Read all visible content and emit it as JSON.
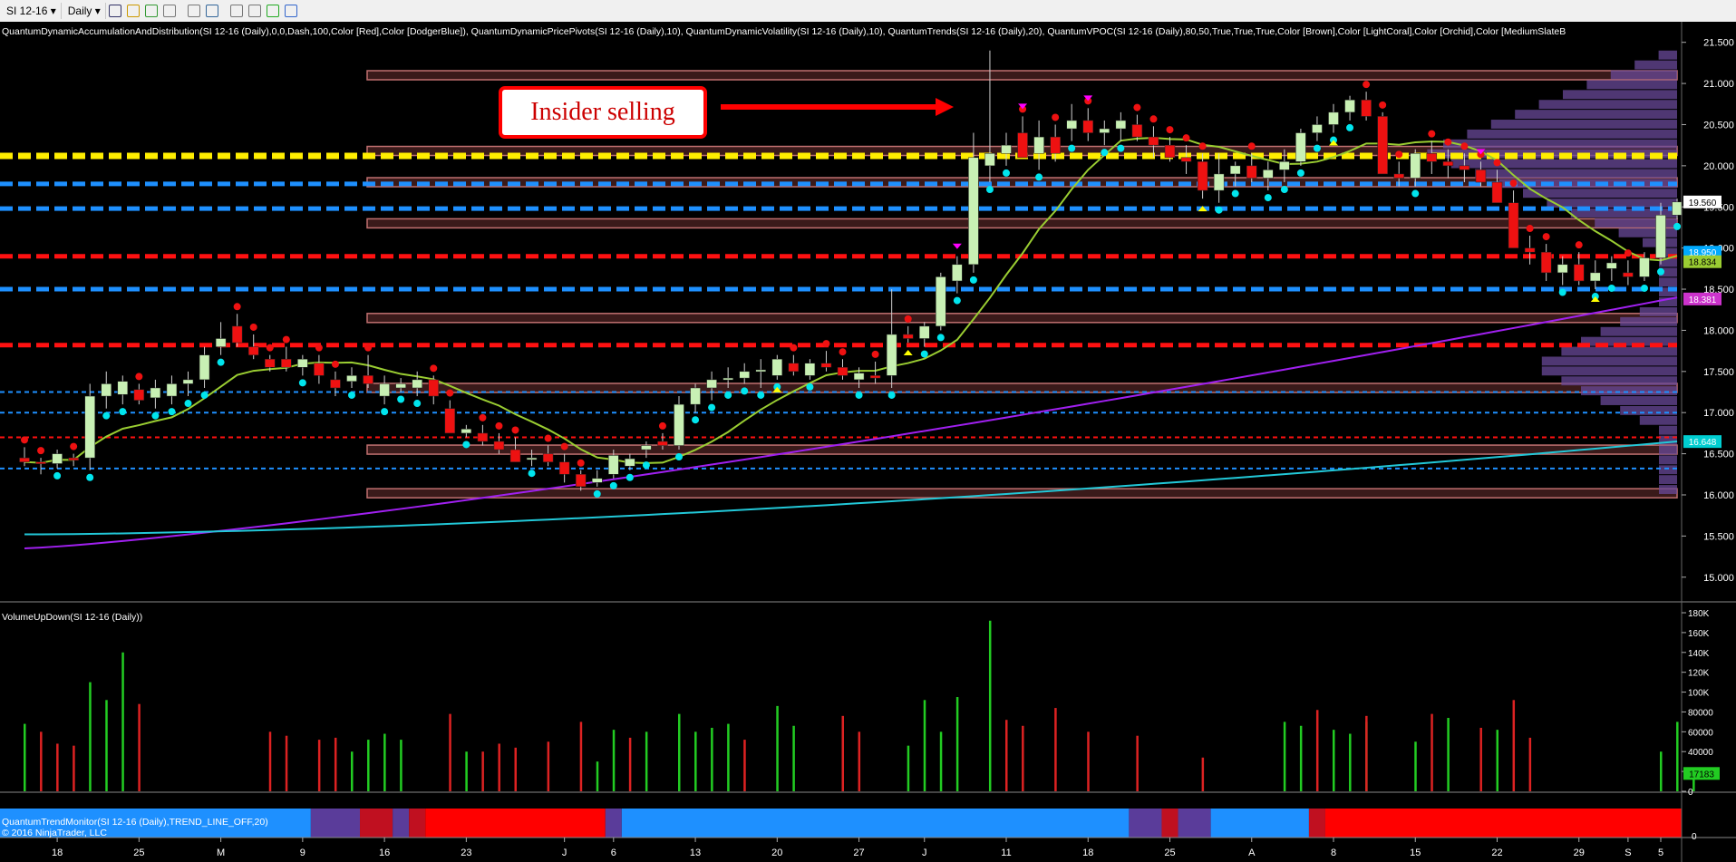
{
  "toolbar": {
    "instrument": "SI 12-16",
    "period": "Daily",
    "icons": [
      "bar-style-icon",
      "pencil-draw-icon",
      "pin-icon",
      "magnet-icon",
      "pointer-icon",
      "zoom-icon",
      "properties-icon",
      "chart-template-icon",
      "strategy-icon",
      "data-box-icon"
    ]
  },
  "price_panel": {
    "indicator_header": "QuantumDynamicAccumulationAndDistribution(SI 12-16 (Daily),0,0,Dash,100,Color [Red],Color [DodgerBlue]), QuantumDynamicPricePivots(SI 12-16 (Daily),10), QuantumDynamicVolatility(SI 12-16 (Daily),10), QuantumTrends(SI 12-16 (Daily),20), QuantumVPOC(SI 12-16 (Daily),80,50,True,True,True,Color [Brown],Color [LightCoral],Color [Orchid],Color [MediumSlateB",
    "annotation": "Insider selling",
    "price_axis_ticks": [
      "21.500",
      "21.000",
      "20.500",
      "20.000",
      "19.500",
      "19.000",
      "18.500",
      "18.000",
      "17.500",
      "17.000",
      "16.500",
      "16.000",
      "15.500",
      "15.000"
    ],
    "price_markers": [
      {
        "value": "19.560",
        "color": "#ffffff",
        "text_color": "#000000"
      },
      {
        "value": "18.950",
        "color": "#00aaff",
        "text_color": "#ffffff"
      },
      {
        "value": "18.834",
        "color": "#9acd32",
        "text_color": "#000000"
      },
      {
        "value": "18.381",
        "color": "#cc33cc",
        "text_color": "#ffffff"
      },
      {
        "value": "16.648",
        "color": "#00ced1",
        "text_color": "#ffffff"
      }
    ]
  },
  "volume_panel": {
    "title": "VolumeUpDown(SI 12-16 (Daily))",
    "axis_ticks": [
      "180K",
      "160K",
      "140K",
      "120K",
      "100K",
      "80000",
      "60000",
      "40000",
      "20000",
      "0"
    ],
    "last_value": "17183"
  },
  "trend_panel": {
    "title": "QuantumTrendMonitor(SI 12-16 (Daily),TREND_LINE_OFF,20)",
    "axis_tick": "0"
  },
  "copyright": "© 2016 NinjaTrader, LLC",
  "x_axis_labels": [
    {
      "label": "18",
      "bar": 2
    },
    {
      "label": "25",
      "bar": 7
    },
    {
      "label": "M",
      "bar": 12
    },
    {
      "label": "9",
      "bar": 17
    },
    {
      "label": "16",
      "bar": 22
    },
    {
      "label": "23",
      "bar": 27
    },
    {
      "label": "J",
      "bar": 33
    },
    {
      "label": "6",
      "bar": 36
    },
    {
      "label": "13",
      "bar": 41
    },
    {
      "label": "20",
      "bar": 46
    },
    {
      "label": "27",
      "bar": 51
    },
    {
      "label": "J",
      "bar": 55
    },
    {
      "label": "11",
      "bar": 60
    },
    {
      "label": "18",
      "bar": 65
    },
    {
      "label": "25",
      "bar": 70
    },
    {
      "label": "A",
      "bar": 75
    },
    {
      "label": "8",
      "bar": 80
    },
    {
      "label": "15",
      "bar": 85
    },
    {
      "label": "22",
      "bar": 90
    },
    {
      "label": "29",
      "bar": 95
    },
    {
      "label": "S",
      "bar": 98
    },
    {
      "label": "5",
      "bar": 100
    }
  ],
  "colors": {
    "background": "#000000",
    "up_candle": "#c8f0b4",
    "down_candle": "#ee1111",
    "up_volume": "#22cc22",
    "down_volume": "#dd2222",
    "trend_line": "#9acd32",
    "ma_purple": "#a020f0",
    "ma_cyan": "#22c8d8",
    "pivot_high": "#ff00ff",
    "pivot_low": "#ffff00",
    "annotation_border": "#ff0000"
  },
  "chart_data": {
    "type": "candlestick",
    "price_range": [
      14.7,
      21.75
    ],
    "volume_range": [
      0,
      180000
    ],
    "candles": [
      [
        16.45,
        16.58,
        16.35,
        16.4
      ],
      [
        16.4,
        16.45,
        16.25,
        16.38
      ],
      [
        16.38,
        16.55,
        16.32,
        16.5
      ],
      [
        16.45,
        16.5,
        16.35,
        16.42
      ],
      [
        16.45,
        17.35,
        16.3,
        17.2
      ],
      [
        17.2,
        17.5,
        17.05,
        17.35
      ],
      [
        17.22,
        17.45,
        17.1,
        17.38
      ],
      [
        17.28,
        17.35,
        17.1,
        17.15
      ],
      [
        17.18,
        17.4,
        17.05,
        17.3
      ],
      [
        17.2,
        17.45,
        17.1,
        17.35
      ],
      [
        17.35,
        17.5,
        17.2,
        17.4
      ],
      [
        17.4,
        17.8,
        17.3,
        17.7
      ],
      [
        17.8,
        18.1,
        17.7,
        17.9
      ],
      [
        18.05,
        18.2,
        17.8,
        17.85
      ],
      [
        17.8,
        17.95,
        17.65,
        17.7
      ],
      [
        17.65,
        17.7,
        17.5,
        17.55
      ],
      [
        17.65,
        17.8,
        17.5,
        17.55
      ],
      [
        17.55,
        17.7,
        17.45,
        17.65
      ],
      [
        17.6,
        17.7,
        17.35,
        17.45
      ],
      [
        17.4,
        17.5,
        17.2,
        17.3
      ],
      [
        17.38,
        17.55,
        17.3,
        17.45
      ],
      [
        17.45,
        17.7,
        17.3,
        17.35
      ],
      [
        17.2,
        17.45,
        17.1,
        17.35
      ],
      [
        17.3,
        17.42,
        17.25,
        17.35
      ],
      [
        17.3,
        17.5,
        17.2,
        17.4
      ],
      [
        17.4,
        17.45,
        17.1,
        17.2
      ],
      [
        17.05,
        17.15,
        16.8,
        16.75
      ],
      [
        16.75,
        16.85,
        16.7,
        16.8
      ],
      [
        16.75,
        16.85,
        16.6,
        16.65
      ],
      [
        16.65,
        16.75,
        16.5,
        16.55
      ],
      [
        16.55,
        16.7,
        16.4,
        16.4
      ],
      [
        16.45,
        16.55,
        16.35,
        16.45
      ],
      [
        16.5,
        16.6,
        16.35,
        16.4
      ],
      [
        16.4,
        16.5,
        16.15,
        16.25
      ],
      [
        16.25,
        16.3,
        16.05,
        16.1
      ],
      [
        16.15,
        16.3,
        16.1,
        16.2
      ],
      [
        16.25,
        16.55,
        16.2,
        16.48
      ],
      [
        16.35,
        16.5,
        16.3,
        16.44
      ],
      [
        16.55,
        16.65,
        16.45,
        16.6
      ],
      [
        16.65,
        16.75,
        16.55,
        16.6
      ],
      [
        16.6,
        17.2,
        16.55,
        17.1
      ],
      [
        17.1,
        17.35,
        17.0,
        17.3
      ],
      [
        17.3,
        17.5,
        17.15,
        17.4
      ],
      [
        17.4,
        17.55,
        17.3,
        17.42
      ],
      [
        17.42,
        17.6,
        17.35,
        17.5
      ],
      [
        17.5,
        17.65,
        17.3,
        17.52
      ],
      [
        17.45,
        17.7,
        17.4,
        17.65
      ],
      [
        17.6,
        17.7,
        17.45,
        17.5
      ],
      [
        17.45,
        17.65,
        17.4,
        17.6
      ],
      [
        17.6,
        17.75,
        17.5,
        17.55
      ],
      [
        17.55,
        17.65,
        17.4,
        17.45
      ],
      [
        17.4,
        17.55,
        17.3,
        17.48
      ],
      [
        17.45,
        17.62,
        17.35,
        17.42
      ],
      [
        17.45,
        18.5,
        17.3,
        17.95
      ],
      [
        17.95,
        18.05,
        17.85,
        17.9
      ],
      [
        17.9,
        18.1,
        17.8,
        18.05
      ],
      [
        18.05,
        18.7,
        18.0,
        18.65
      ],
      [
        18.6,
        18.9,
        18.45,
        18.8
      ],
      [
        18.8,
        20.4,
        18.7,
        20.1
      ],
      [
        20.0,
        21.4,
        19.8,
        20.15
      ],
      [
        20.15,
        20.4,
        20.0,
        20.25
      ],
      [
        20.4,
        20.6,
        20.15,
        20.1
      ],
      [
        20.15,
        20.55,
        19.95,
        20.35
      ],
      [
        20.35,
        20.5,
        20.05,
        20.15
      ],
      [
        20.45,
        20.75,
        20.3,
        20.55
      ],
      [
        20.55,
        20.7,
        20.3,
        20.4
      ],
      [
        20.4,
        20.55,
        20.25,
        20.45
      ],
      [
        20.45,
        20.65,
        20.3,
        20.55
      ],
      [
        20.5,
        20.62,
        20.3,
        20.35
      ],
      [
        20.35,
        20.48,
        20.1,
        20.25
      ],
      [
        20.25,
        20.35,
        20.05,
        20.1
      ],
      [
        20.1,
        20.25,
        19.9,
        20.05
      ],
      [
        20.05,
        20.15,
        19.6,
        19.7
      ],
      [
        19.7,
        20.15,
        19.55,
        19.9
      ],
      [
        19.9,
        20.05,
        19.75,
        20.0
      ],
      [
        20.0,
        20.15,
        19.8,
        19.85
      ],
      [
        19.85,
        20.05,
        19.7,
        19.95
      ],
      [
        19.95,
        20.2,
        19.8,
        20.05
      ],
      [
        20.05,
        20.45,
        20.0,
        20.4
      ],
      [
        20.4,
        20.6,
        20.3,
        20.5
      ],
      [
        20.5,
        20.75,
        20.4,
        20.65
      ],
      [
        20.65,
        20.85,
        20.55,
        20.8
      ],
      [
        20.8,
        20.9,
        20.55,
        20.6
      ],
      [
        20.6,
        20.65,
        20.1,
        19.9
      ],
      [
        19.9,
        20.05,
        19.75,
        19.85
      ],
      [
        19.85,
        20.2,
        19.75,
        20.15
      ],
      [
        20.15,
        20.3,
        19.9,
        20.05
      ],
      [
        20.05,
        20.2,
        19.85,
        20.0
      ],
      [
        20.0,
        20.15,
        19.8,
        19.95
      ],
      [
        19.95,
        20.05,
        19.75,
        19.8
      ],
      [
        19.8,
        19.95,
        19.6,
        19.55
      ],
      [
        19.55,
        19.7,
        19.05,
        19.0
      ],
      [
        19.0,
        19.15,
        18.8,
        18.95
      ],
      [
        18.95,
        19.05,
        18.6,
        18.7
      ],
      [
        18.7,
        18.9,
        18.55,
        18.8
      ],
      [
        18.8,
        18.95,
        18.55,
        18.6
      ],
      [
        18.6,
        18.85,
        18.5,
        18.7
      ],
      [
        18.75,
        18.9,
        18.6,
        18.82
      ],
      [
        18.7,
        18.85,
        18.55,
        18.65
      ],
      [
        18.65,
        18.95,
        18.6,
        18.88
      ],
      [
        18.88,
        19.55,
        18.8,
        19.4
      ],
      [
        19.4,
        19.6,
        19.35,
        19.56
      ]
    ],
    "volume_up": [
      68000,
      0,
      0,
      0,
      110000,
      92000,
      140000,
      0,
      0,
      0,
      0,
      0,
      0,
      0,
      0,
      0,
      0,
      0,
      0,
      0,
      40000,
      52000,
      58000,
      52000,
      0,
      0,
      0,
      40000,
      0,
      0,
      0,
      0,
      0,
      0,
      0,
      30000,
      62000,
      0,
      60000,
      0,
      78000,
      60000,
      64000,
      68000,
      0,
      0,
      86000,
      66000,
      0,
      0,
      0,
      0,
      0,
      0,
      46000,
      92000,
      60000,
      95000,
      0,
      172000,
      0,
      0,
      0,
      0,
      0,
      0,
      0,
      0,
      0,
      0,
      0,
      0,
      0,
      0,
      0,
      0,
      0,
      70000,
      66000,
      0,
      62000,
      58000,
      70000,
      0,
      0,
      50000,
      0,
      74000,
      0,
      0,
      62000,
      0,
      0,
      0,
      0,
      0,
      0,
      0,
      0,
      0,
      40000,
      70000,
      18000
    ],
    "volume_down": [
      0,
      60000,
      48000,
      46000,
      0,
      0,
      0,
      88000,
      0,
      0,
      0,
      0,
      0,
      0,
      0,
      60000,
      56000,
      0,
      52000,
      54000,
      0,
      0,
      0,
      0,
      0,
      0,
      78000,
      0,
      40000,
      48000,
      44000,
      0,
      50000,
      0,
      70000,
      0,
      0,
      54000,
      0,
      0,
      0,
      0,
      0,
      0,
      52000,
      0,
      0,
      0,
      0,
      0,
      76000,
      60000,
      0,
      0,
      0,
      0,
      0,
      0,
      0,
      0,
      72000,
      66000,
      0,
      84000,
      0,
      60000,
      0,
      0,
      56000,
      0,
      0,
      0,
      34000,
      0,
      0,
      0,
      0,
      0,
      0,
      82000,
      0,
      0,
      76000,
      0,
      0,
      0,
      78000,
      0,
      0,
      64000,
      0,
      92000,
      54000,
      0,
      0,
      0,
      0,
      0,
      0,
      0,
      0,
      0,
      0
    ],
    "pivots_high": [
      57,
      61,
      65,
      89
    ],
    "pivots_low": [
      46,
      54,
      72,
      80,
      96
    ],
    "dashed_levels": [
      {
        "price": 20.12,
        "color": "#ffee00"
      },
      {
        "price": 19.78,
        "color": "#1e90ff"
      },
      {
        "price": 19.48,
        "color": "#1e90ff"
      },
      {
        "price": 18.9,
        "color": "#ff1111"
      },
      {
        "price": 18.5,
        "color": "#1e90ff"
      },
      {
        "price": 17.82,
        "color": "#ff1111"
      },
      {
        "price": 17.25,
        "color": "#1e90ff"
      },
      {
        "price": 17.0,
        "color": "#1e90ff"
      },
      {
        "price": 16.7,
        "color": "#ff1111"
      },
      {
        "price": 16.32,
        "color": "#1e90ff"
      }
    ],
    "vpoc_bands": [
      21.1,
      20.18,
      19.8,
      19.3,
      18.15,
      17.3,
      16.55,
      16.02
    ],
    "trend_segments": [
      {
        "from": 0,
        "to": 18,
        "color": "#1e90ff"
      },
      {
        "from": 18,
        "to": 21,
        "color": "#5a3c9a"
      },
      {
        "from": 21,
        "to": 23,
        "color": "#c01020"
      },
      {
        "from": 23,
        "to": 24,
        "color": "#5a3c9a"
      },
      {
        "from": 24,
        "to": 25,
        "color": "#c01020"
      },
      {
        "from": 25,
        "to": 36,
        "color": "#ff0000"
      },
      {
        "from": 36,
        "to": 37,
        "color": "#5a3c9a"
      },
      {
        "from": 37,
        "to": 68,
        "color": "#1e90ff"
      },
      {
        "from": 68,
        "to": 70,
        "color": "#5a3c9a"
      },
      {
        "from": 70,
        "to": 71,
        "color": "#c01020"
      },
      {
        "from": 71,
        "to": 73,
        "color": "#5a3c9a"
      },
      {
        "from": 73,
        "to": 79,
        "color": "#1e90ff"
      },
      {
        "from": 79,
        "to": 80,
        "color": "#c01020"
      },
      {
        "from": 80,
        "to": 102,
        "color": "#ff0000"
      }
    ]
  }
}
